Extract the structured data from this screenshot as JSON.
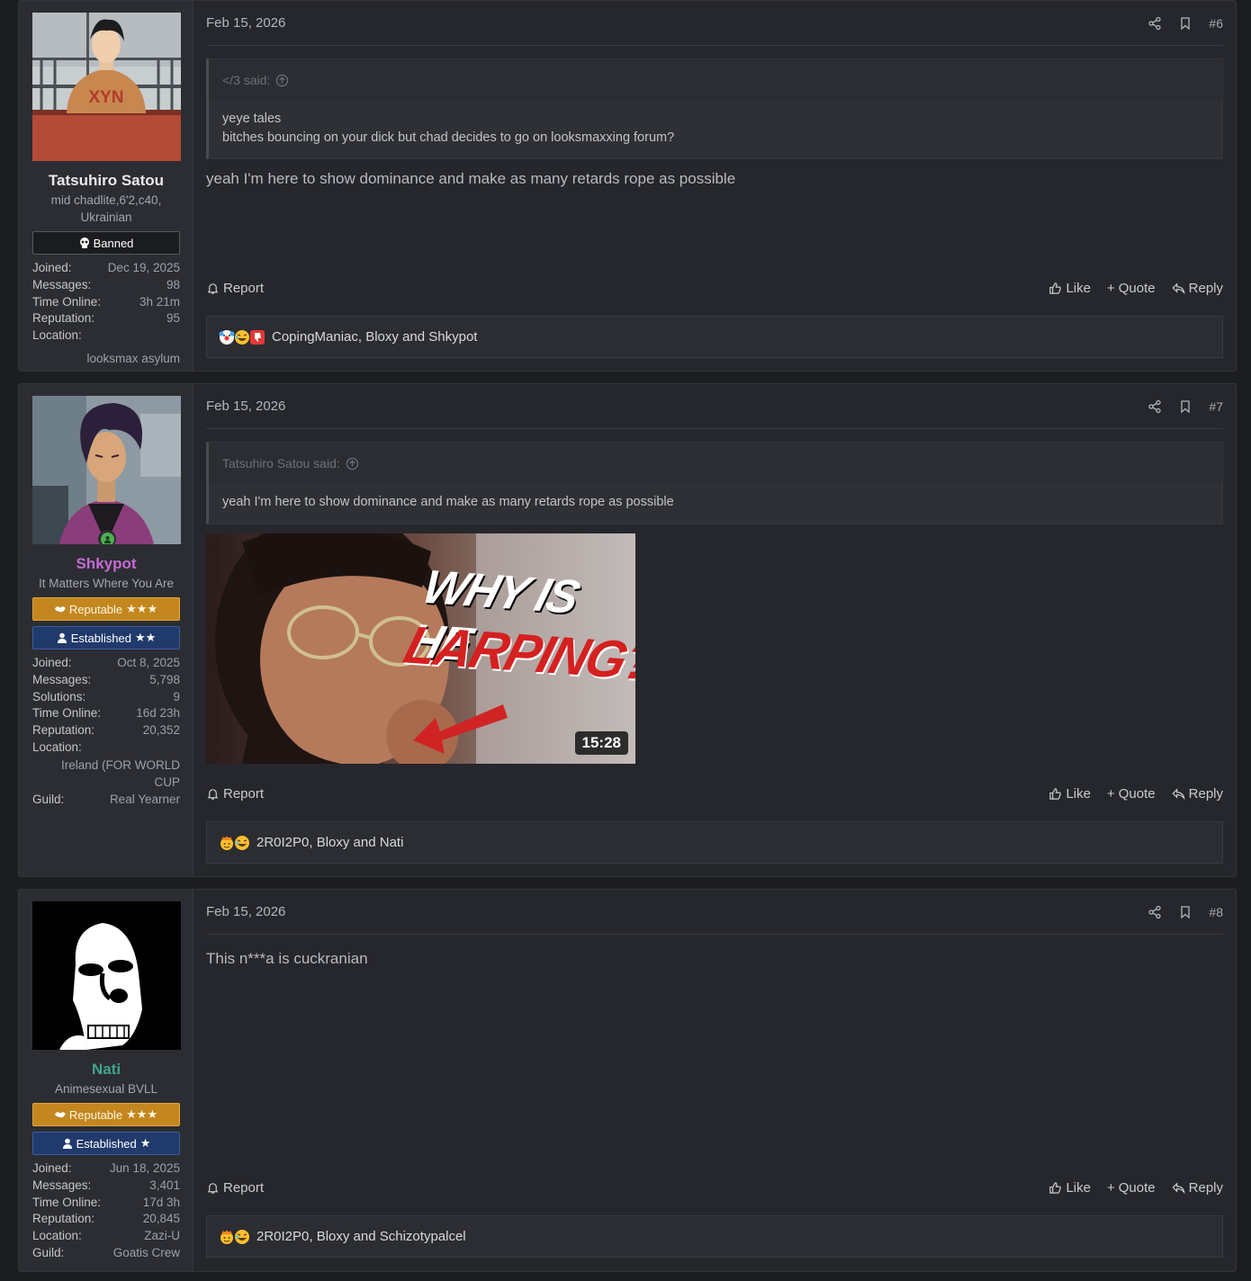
{
  "posts": [
    {
      "user": {
        "name": "Tatsuhiro Satou",
        "name_color": "#e9eaed",
        "title": "mid chadlite,6'2,c40, Ukrainian",
        "banners": [
          {
            "type": "banned",
            "label": "Banned",
            "stars": ""
          }
        ],
        "stats": [
          {
            "k": "Joined:",
            "v": "Dec 19, 2025"
          },
          {
            "k": "Messages:",
            "v": "98"
          },
          {
            "k": "Time Online:",
            "v": "3h 21m"
          },
          {
            "k": "Reputation:",
            "v": "95"
          },
          {
            "k": "Location:",
            "v": ""
          }
        ],
        "location_full": "looksmax asylum",
        "guild": null
      },
      "date": "Feb 15, 2026",
      "number": "#6",
      "quote": {
        "author": "</3 said:",
        "lines": [
          "yeye tales",
          "bitches bouncing on your dick but chad decides to go on looksmaxxing forum?"
        ]
      },
      "message": "yeah I'm here to show dominance and make as many retards rope as possible",
      "reactions": "CopingManiac, Bloxy and Shkypot"
    },
    {
      "user": {
        "name": "Shkypot",
        "name_color": "#c56bd4",
        "title": "It Matters Where You Are",
        "banners": [
          {
            "type": "reputable",
            "label": "Reputable",
            "stars": "★★★"
          },
          {
            "type": "established",
            "label": "Established",
            "stars": "★★"
          }
        ],
        "stats": [
          {
            "k": "Joined:",
            "v": "Oct 8, 2025"
          },
          {
            "k": "Messages:",
            "v": "5,798"
          },
          {
            "k": "Solutions:",
            "v": "9"
          },
          {
            "k": "Time Online:",
            "v": "16d 23h"
          },
          {
            "k": "Reputation:",
            "v": "20,352"
          },
          {
            "k": "Location:",
            "v": ""
          }
        ],
        "location_full": "Ireland (FOR WORLD CUP",
        "guild": {
          "k": "Guild:",
          "v": "Real Yearner"
        }
      },
      "date": "Feb 15, 2026",
      "number": "#7",
      "quote": {
        "author": "Tatsuhiro Satou said:",
        "lines": [
          "yeah I'm here to show dominance and make as many retards rope as possible"
        ]
      },
      "video": {
        "line1": "WHY IS HE",
        "line2": "LARPING?",
        "duration": "15:28"
      },
      "reactions": "2R0I2P0, Bloxy and Nati"
    },
    {
      "user": {
        "name": "Nati",
        "name_color": "#3fa58f",
        "title": "Animesexual BVLL",
        "banners": [
          {
            "type": "reputable",
            "label": "Reputable",
            "stars": "★★★"
          },
          {
            "type": "established",
            "label": "Established",
            "stars": "★"
          }
        ],
        "stats": [
          {
            "k": "Joined:",
            "v": "Jun 18, 2025"
          },
          {
            "k": "Messages:",
            "v": "3,401"
          },
          {
            "k": "Time Online:",
            "v": "17d 3h"
          },
          {
            "k": "Reputation:",
            "v": "20,845"
          },
          {
            "k": "Location:",
            "v": "Zazi-U"
          },
          {
            "k": "Guild:",
            "v": "Goatis Crew"
          }
        ],
        "location_full": null,
        "guild": null
      },
      "date": "Feb 15, 2026",
      "number": "#8",
      "message": "This n***a is cuckranian",
      "reactions": "2R0I2P0, Bloxy and Schizotypalcel"
    }
  ],
  "actions": {
    "report": "Report",
    "like": "Like",
    "quote": "Quote",
    "reply": "Reply"
  }
}
